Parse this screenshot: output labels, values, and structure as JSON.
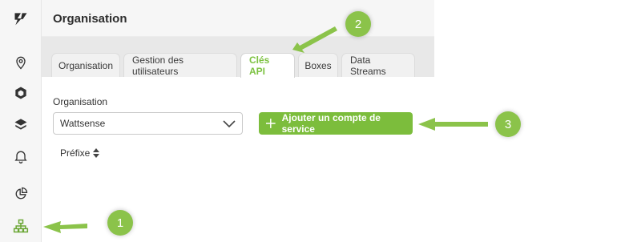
{
  "header": {
    "title": "Organisation"
  },
  "tabs": [
    {
      "label": "Organisation",
      "active": false
    },
    {
      "label": "Gestion des utilisateurs",
      "active": false
    },
    {
      "label": "Clés API",
      "active": true
    },
    {
      "label": "Boxes",
      "active": false
    },
    {
      "label": "Data Streams",
      "active": false
    }
  ],
  "form": {
    "organisation_label": "Organisation",
    "organisation_value": "Wattsense",
    "add_button_label": "Ajouter un compte de service"
  },
  "table": {
    "columns": [
      {
        "label": "Préfixe",
        "sortable": true
      }
    ]
  },
  "sidebar": {
    "icons": [
      "logo-icon",
      "location-icon",
      "cube-icon",
      "layers-icon",
      "bell-icon",
      "pie-chart-icon",
      "organisation-icon"
    ]
  },
  "annotations": [
    {
      "label": "1"
    },
    {
      "label": "2"
    },
    {
      "label": "3"
    }
  ],
  "colors": {
    "accent": "#7cbd3c",
    "annotation": "#8bc34a"
  }
}
